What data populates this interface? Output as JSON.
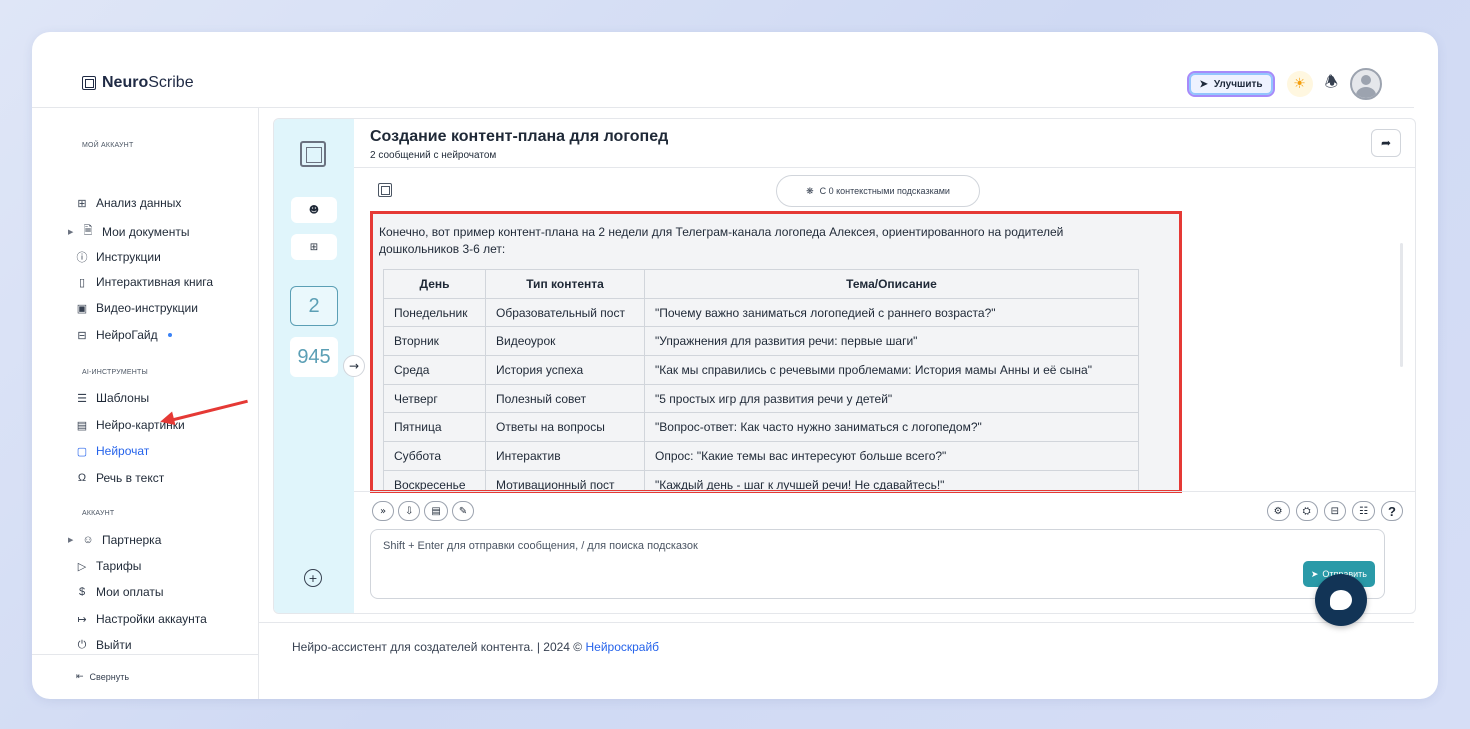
{
  "brand": {
    "name_bold": "Neuro",
    "name_regular": "Scribe"
  },
  "header": {
    "upgrade_label": "Улучшить"
  },
  "sidebar": {
    "sections": [
      {
        "title": "МОЙ АККАУНТ"
      },
      {
        "title": "AI-ИНСТРУМЕНТЫ"
      },
      {
        "title": "АККАУНТ"
      }
    ],
    "items": [
      {
        "label": "Анализ данных"
      },
      {
        "label": "Мои документы"
      },
      {
        "label": "Инструкции"
      },
      {
        "label": "Интерактивная книга"
      },
      {
        "label": "Видео-инструкции"
      },
      {
        "label": "НейроГайд"
      },
      {
        "label": "Шаблоны"
      },
      {
        "label": "Нейро-картинки"
      },
      {
        "label": "Нейрочат"
      },
      {
        "label": "Речь в текст"
      },
      {
        "label": "Партнерка"
      },
      {
        "label": "Тарифы"
      },
      {
        "label": "Мои оплаты"
      },
      {
        "label": "Настройки аккаунта"
      },
      {
        "label": "Выйти"
      }
    ],
    "collapse_label": "Свернуть"
  },
  "chat_list": {
    "numbers": [
      "2",
      "945"
    ]
  },
  "chat": {
    "title": "Создание контент-плана для логопед",
    "subtitle": "2 сообщений с нейрочатом",
    "context_hint": "С 0 контекстными подсказками",
    "message_intro": "Конечно, вот пример контент-плана на 2 недели для Телеграм-канала логопеда Алексея, ориентированного на родителей дошкольников 3-6 лет:",
    "table": {
      "headers": [
        "День",
        "Тип контента",
        "Тема/Описание"
      ],
      "rows": [
        [
          "Понедельник",
          "Образовательный пост",
          "\"Почему важно заниматься логопедией с раннего возраста?\""
        ],
        [
          "Вторник",
          "Видеоурок",
          "\"Упражнения для развития речи: первые шаги\""
        ],
        [
          "Среда",
          "История успеха",
          "\"Как мы справились с речевыми проблемами: История мамы Анны и её сына\""
        ],
        [
          "Четверг",
          "Полезный совет",
          "\"5 простых игр для развития речи у детей\""
        ],
        [
          "Пятница",
          "Ответы на вопросы",
          "\"Вопрос-ответ: Как часто нужно заниматься с логопедом?\""
        ],
        [
          "Суббота",
          "Интерактив",
          "Опрос: \"Какие темы вас интересуют больше всего?\""
        ],
        [
          "Воскресенье",
          "Мотивационный пост",
          "\"Каждый день - шаг к лучшей речи! Не сдавайтесь!\""
        ]
      ]
    },
    "input_placeholder": "Shift + Enter для отправки сообщения, / для поиска подсказок",
    "send_label": "Отправить",
    "help_label": "?"
  },
  "footer": {
    "text": "Нейро-ассистент для создателей контента.  | 2024 © ",
    "link": "Нейроскрайб"
  },
  "colors": {
    "accent": "#2563eb",
    "send_button": "#2a9aa8",
    "highlight_border": "#e53935",
    "chat_rail": "#e0f5fb",
    "support_bubble": "#123456"
  }
}
